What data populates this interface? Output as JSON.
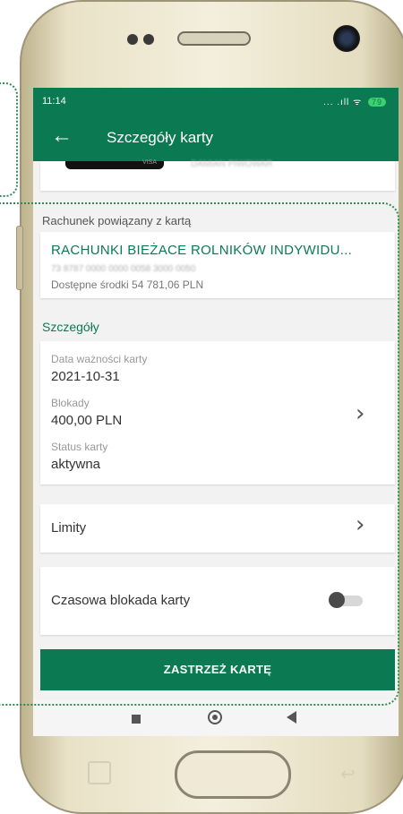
{
  "status_bar": {
    "time": "11:14",
    "signal": "... .ıll",
    "wifi": "ᯤ",
    "battery": "79"
  },
  "app_bar": {
    "back_icon": "arrow-left-icon",
    "title": "Szczegóły karty"
  },
  "card": {
    "logo_text": "VISA",
    "owner": "DAMIAN PIWOWAR"
  },
  "linked_account": {
    "section_label": "Rachunek powiązany z kartą",
    "name": "RACHUNKI BIEŻACE ROLNIKÓW INDYWIDU...",
    "number": "73 8787 0000 0000 0058 3000 0050",
    "balance": "Dostępne środki 54 781,06 PLN"
  },
  "details": {
    "section_label": "Szczegóły",
    "expiry_label": "Data ważności karty",
    "expiry_value": "2021-10-31",
    "blocks_label": "Blokady",
    "blocks_value": "400,00 PLN",
    "status_label": "Status karty",
    "status_value": "aktywna"
  },
  "limits": {
    "label": "Limity"
  },
  "temp_block": {
    "label": "Czasowa blokada karty",
    "enabled": false
  },
  "action": {
    "label": "ZASTRZEŻ KARTĘ"
  },
  "colors": {
    "accent": "#0b7a53",
    "annotation": "#2e8b4f"
  }
}
